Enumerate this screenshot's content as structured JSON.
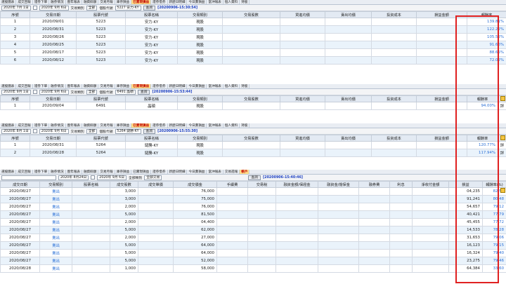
{
  "accent": "#e02020",
  "panels": {
    "p1": {
      "tabs": [
        "選股圖表",
        "成交回報",
        "證券下單",
        "融券情況",
        "歷年報表",
        "融資餘額",
        "交易月報",
        "庫存損益",
        "已實現損益",
        "證券借券",
        "新歷日明細",
        "今日賣損益",
        "當沖報表",
        "個人資料",
        "持股"
      ],
      "active_tab_index": 8,
      "toolbar": {
        "date_from": "2020年 7月 1日",
        "date_to": "2020年 9月 6日",
        "type_label": "交易類別",
        "type_value": "全部",
        "stock_label": "個股代號",
        "stock_value": "5227 安力-KY",
        "query": "查詢",
        "timestamp": "[20200906-15:30:54]"
      },
      "columns": [
        "序號",
        "交易日期",
        "股票代號",
        "股票名稱",
        "交易類別",
        "交易股數",
        "買進均價",
        "賣出均價",
        "投資成本",
        "損益金額",
        "報酬率"
      ],
      "rows": [
        [
          "1",
          "2020/09/01",
          "5223",
          "安力-KY",
          "現股",
          "",
          "",
          "",
          "",
          "",
          "139.81%"
        ],
        [
          "2",
          "2020/08/31",
          "5223",
          "安力-KY",
          "現股",
          "",
          "",
          "",
          "",
          "",
          "122.22%"
        ],
        [
          "3",
          "2020/08/26",
          "5223",
          "安力-KY",
          "現股",
          "",
          "",
          "",
          "",
          "",
          "105.52%"
        ],
        [
          "4",
          "2020/08/25",
          "5223",
          "安力-KY",
          "現股",
          "",
          "",
          "",
          "",
          "",
          "91.66%"
        ],
        [
          "5",
          "2020/08/17",
          "5223",
          "安力-KY",
          "現股",
          "",
          "",
          "",
          "",
          "",
          "88.65%"
        ],
        [
          "6",
          "2020/08/12",
          "5223",
          "安力-KY",
          "現股",
          "",
          "",
          "",
          "",
          "",
          "72.02%"
        ]
      ]
    },
    "p2": {
      "tabs": [
        "選股圖表",
        "成交回報",
        "證券下單",
        "融券情況",
        "歷年報表",
        "融資餘額",
        "交易月報",
        "庫存損益",
        "已實現損益",
        "證券借券",
        "新歷日明細",
        "今日賣損益",
        "當沖報表",
        "個人資料",
        "持股"
      ],
      "active_tab_index": 8,
      "toolbar": {
        "date_from": "2020年 9月 1日",
        "date_to": "2020年 9月 6日",
        "type_label": "交易類別",
        "type_value": "全部",
        "stock_label": "個股代號",
        "stock_value": "6491 晶碩",
        "query": "查詢",
        "timestamp": "[20200906-15:53:44]"
      },
      "columns": [
        "序號",
        "交易日期",
        "股票代號",
        "股票名稱",
        "交易類別",
        "交易股數",
        "買進均價",
        "賣出均價",
        "投資成本",
        "損益金額",
        "報酬率",
        "詳"
      ],
      "rows": [
        [
          "1",
          "2020/09/04",
          "6491",
          "晶碩",
          "現股",
          "",
          "",
          "",
          "",
          "",
          "94.00%",
          "詳"
        ]
      ]
    },
    "p3": {
      "tabs": [
        "選股圖表",
        "成交回報",
        "證券下單",
        "融券情況",
        "歷年報表",
        "融資餘額",
        "交易月報",
        "庫存損益",
        "已實現損益",
        "證券借券",
        "新歷日明細",
        "今日賣損益",
        "當沖報表",
        "個人資料",
        "持股"
      ],
      "active_tab_index": 8,
      "toolbar": {
        "date_from": "2020年 8月 1日",
        "date_to": "2020年 9月 6日",
        "type_label": "交易類別",
        "type_value": "全部",
        "stock_label": "個股代號",
        "stock_value": "5264 鐽勝-KY",
        "query": "查詢",
        "timestamp": "[20200906-15:55:30]"
      },
      "columns": [
        "序號",
        "交易日期",
        "股票代號",
        "股票名稱",
        "交易類別",
        "交易股數",
        "買進均價",
        "賣出均價",
        "投資成本",
        "損益金額",
        "報酬率",
        "詳"
      ],
      "rows": [
        [
          "1",
          "2020/08/31",
          "5264",
          "鐽勝-KY",
          "現股",
          "",
          "",
          "",
          "",
          "",
          "120.77%",
          "詳"
        ],
        [
          "2",
          "2020/08/28",
          "5264",
          "鐽勝-KY",
          "現股",
          "",
          "",
          "",
          "",
          "",
          "117.94%",
          "詳"
        ]
      ]
    },
    "p4": {
      "tabs": [
        "選股圖表",
        "成交回報",
        "證券下單",
        "融券情況",
        "歷年報表",
        "融資餘額",
        "交易月報",
        "庫存損益",
        "已實現損益",
        "證券借券",
        "新歷日明細",
        "今日賣損益",
        "當沖報表",
        "交易週報",
        "帳戶"
      ],
      "active_tab_index": 14,
      "toolbar": {
        "date_from": "2020年 8月24日",
        "date_to": "2020年 9月 6日",
        "type_label": "全部類別",
        "type_value": "全部交易",
        "stock_label": "",
        "stock_value": "",
        "query": "查詢",
        "timestamp": "[20200906-15:40:46]"
      },
      "columns": [
        "成交日期",
        "交易類別",
        "股票名稱",
        "成交股數",
        "成交單價",
        "成交價金",
        "手續費",
        "交易稅",
        "融資金額/保證金",
        "融資金/擔保金",
        "融券費",
        "利息",
        "淨收付金額",
        "損益",
        "報酬率(%)"
      ],
      "rows": [
        [
          "2020/08/27",
          "賣出",
          "",
          "3,000",
          "",
          "76,000",
          "",
          "",
          "",
          "",
          "",
          "",
          "",
          "04,235",
          "82.50"
        ],
        [
          "2020/08/27",
          "賣出",
          "",
          "3,000",
          "",
          "75,000",
          "",
          "",
          "",
          "",
          "",
          "",
          "",
          "91,241",
          "80.48"
        ],
        [
          "2020/08/27",
          "賣出",
          "",
          "2,000",
          "",
          "76,000",
          "",
          "",
          "",
          "",
          "",
          "",
          "",
          "54,657",
          "79.12"
        ],
        [
          "2020/08/27",
          "賣出",
          "",
          "5,000",
          "",
          "81,500",
          "",
          "",
          "",
          "",
          "",
          "",
          "",
          "40,421",
          "77.79"
        ],
        [
          "2020/08/27",
          "賣出",
          "",
          "2,000",
          "",
          "04,400",
          "",
          "",
          "",
          "",
          "",
          "",
          "",
          "45,455",
          "77.72"
        ],
        [
          "2020/08/27",
          "賣出",
          "",
          "5,000",
          "",
          "62,000",
          "",
          "",
          "",
          "",
          "",
          "",
          "",
          "14,533",
          "78.28"
        ],
        [
          "2020/08/27",
          "賣出",
          "",
          "2,000",
          "",
          "27,000",
          "",
          "",
          "",
          "",
          "",
          "",
          "",
          "31,653",
          "79.06"
        ],
        [
          "2020/08/27",
          "賣出",
          "",
          "5,000",
          "",
          "64,000",
          "",
          "",
          "",
          "",
          "",
          "",
          "",
          "16,123",
          "79.15"
        ],
        [
          "2020/08/27",
          "賣出",
          "",
          "5,000",
          "",
          "64,000",
          "",
          "",
          "",
          "",
          "",
          "",
          "",
          "16,324",
          "79.40"
        ],
        [
          "2020/08/27",
          "賣出",
          "",
          "5,000",
          "",
          "52,000",
          "",
          "",
          "",
          "",
          "",
          "",
          "",
          "23,275",
          "79.46"
        ],
        [
          "2020/08/28",
          "賣出",
          "",
          "1,000",
          "",
          "58,000",
          "",
          "",
          "",
          "",
          "",
          "",
          "",
          "64,384",
          "33.60"
        ]
      ]
    }
  }
}
